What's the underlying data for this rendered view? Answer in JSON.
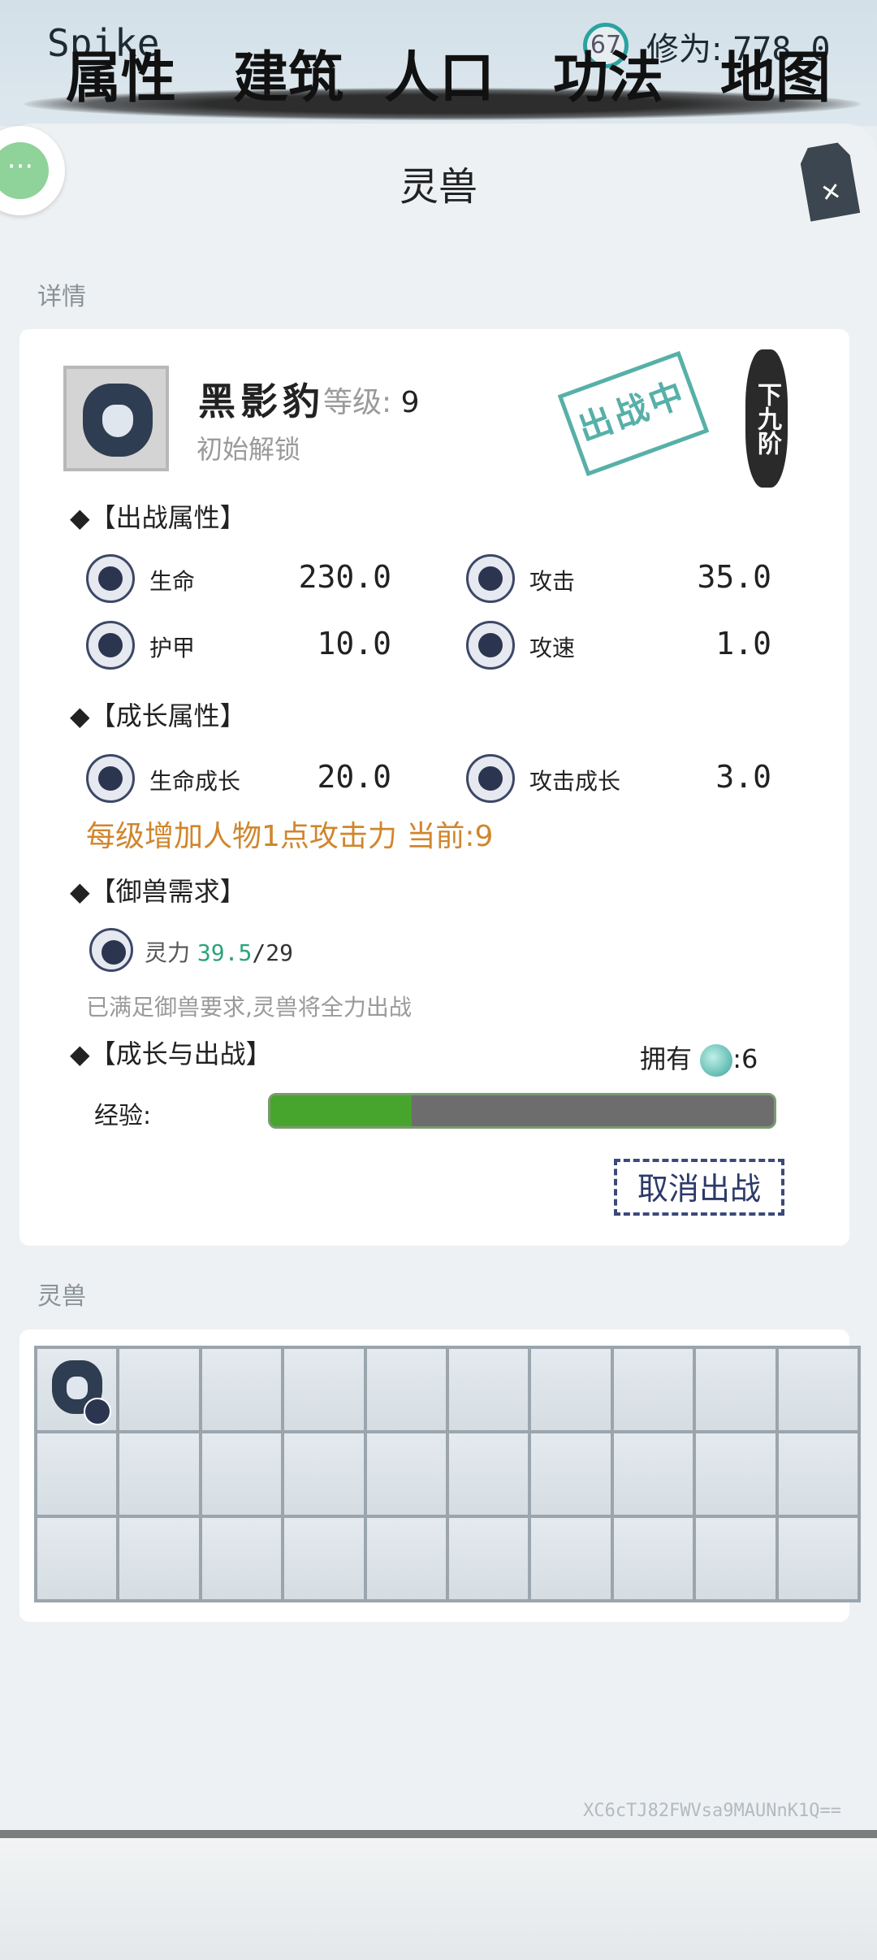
{
  "header": {
    "player_name": "Spike",
    "level": "67",
    "cultivation_label": "修为:",
    "cultivation_value": "778.0"
  },
  "page": {
    "title": "灵兽"
  },
  "details": {
    "section_label": "详情",
    "pet_name": "黑影豹",
    "level_label": "等级:",
    "level_value": "9",
    "unlock_text": "初始解锁",
    "stamp_text": "出战中",
    "rank_text": "下九阶",
    "battle_attrs_title": "◆【出战属性】",
    "battle_attrs": [
      {
        "label": "生命",
        "value": "230.0",
        "icon": "heart-icon"
      },
      {
        "label": "攻击",
        "value": "35.0",
        "icon": "sword-icon"
      },
      {
        "label": "护甲",
        "value": "10.0",
        "icon": "shield-icon"
      },
      {
        "label": "攻速",
        "value": "1.0",
        "icon": "speed-sword-icon"
      }
    ],
    "growth_attrs_title": "◆【成长属性】",
    "growth_attrs": [
      {
        "label": "生命成长",
        "value": "20.0",
        "icon": "heart-growth-icon"
      },
      {
        "label": "攻击成长",
        "value": "3.0",
        "icon": "sword-growth-icon"
      }
    ],
    "growth_note": "每级增加人物1点攻击力 当前:9",
    "requirement_title": "◆【御兽需求】",
    "requirement_label": "灵力",
    "requirement_current": "39.5",
    "requirement_max": "/29",
    "requirement_ok": "已满足御兽要求,灵兽将全力出战",
    "growth_battle_title": "◆【成长与出战】",
    "own_label": "拥有",
    "own_count": ":6",
    "exp_label": "经验:",
    "exp_progress": 0.28,
    "cancel_button": "取消出战"
  },
  "inventory": {
    "section_label": "灵兽",
    "slots_total": 30,
    "occupied_slots": 1
  },
  "watermark": "XC6cTJ82FWVsa9MAUNnK1Q==",
  "bottom_nav": [
    "属性",
    "建筑",
    "人口",
    "功法",
    "地图"
  ]
}
